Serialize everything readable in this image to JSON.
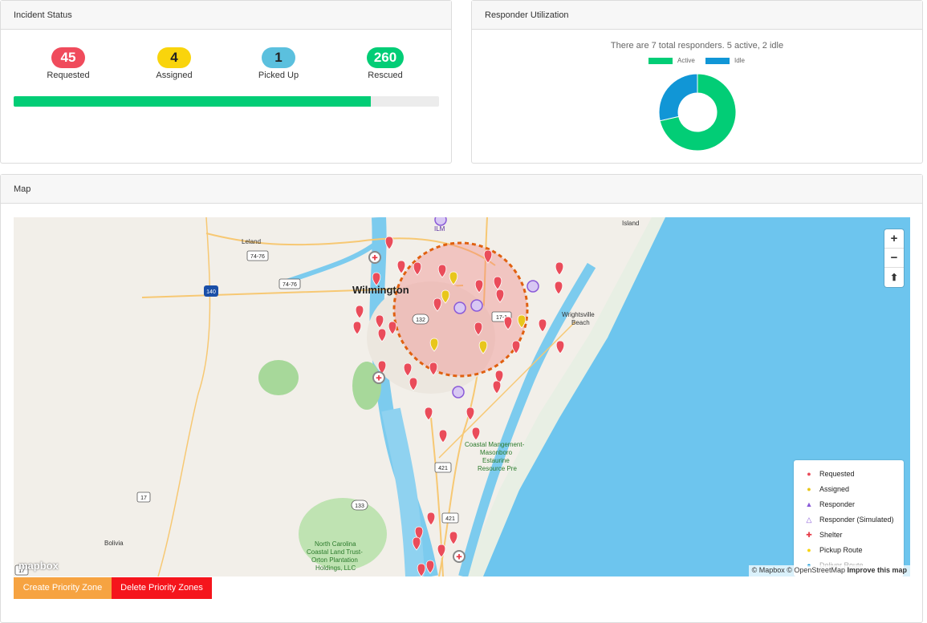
{
  "incident": {
    "title": "Incident Status",
    "stats": [
      {
        "value": "45",
        "label": "Requested",
        "color": "#f04b5c",
        "text_color": "#ffffff"
      },
      {
        "value": "4",
        "label": "Assigned",
        "color": "#f9d40c",
        "text_color": "#222222"
      },
      {
        "value": "1",
        "label": "Picked Up",
        "color": "#5bc0de",
        "text_color": "#222222"
      },
      {
        "value": "260",
        "label": "Rescued",
        "color": "#02cd76",
        "text_color": "#ffffff"
      }
    ],
    "progress_fraction": 0.84
  },
  "utilization": {
    "title": "Responder Utilization",
    "summary": "There are 7 total responders. 5 active, 2 idle",
    "legend": [
      {
        "label": "Active",
        "color": "#02cd76"
      },
      {
        "label": "Idle",
        "color": "#1196d6"
      }
    ],
    "chart_data": {
      "type": "pie",
      "categories": [
        "Active",
        "Idle"
      ],
      "values": [
        5,
        2
      ]
    }
  },
  "map_panel": {
    "title": "Map",
    "place_labels": {
      "wilmington": "Wilmington",
      "leland": "Leland",
      "wrightsville": "Wrightsville",
      "beach": "Beach",
      "bolivia": "Bolivia",
      "ilm": "ILM",
      "island": "Island",
      "coastal1": "Coastal Mangement-",
      "coastal2": "Masonboro",
      "coastal3": "Estaurine",
      "coastal4": "Resource Pre",
      "nc1": "North Carolina",
      "nc2": "Coastal Land Trust-",
      "nc3": "Orton Plantation",
      "nc4": "Holdings, LLC"
    },
    "road_shields": [
      "74-76",
      "74-76",
      "140",
      "17",
      "17",
      "421",
      "421",
      "133",
      "132",
      "17-1"
    ],
    "controls": {
      "zoom_in": "+",
      "zoom_out": "−",
      "reset": "⬆"
    },
    "legend": [
      {
        "label": "Requested",
        "icon": "requested-pin-icon",
        "color": "#ea4c5a"
      },
      {
        "label": "Assigned",
        "icon": "assigned-pin-icon",
        "color": "#e8c61b"
      },
      {
        "label": "Responder",
        "icon": "responder-icon",
        "color": "#8a5ad8"
      },
      {
        "label": "Responder (Simulated)",
        "icon": "responder-simulated-icon",
        "color": "#8a5ad8"
      },
      {
        "label": "Shelter",
        "icon": "shelter-icon",
        "color": "#e63946"
      },
      {
        "label": "Pickup Route",
        "icon": "pickup-route-dot",
        "color": "#f9d40c"
      },
      {
        "label": "Deliver Route",
        "icon": "deliver-route-dot",
        "color": "#1196d6"
      }
    ],
    "attribution": {
      "mapbox": "© Mapbox",
      "osm": "© OpenStreetMap",
      "improve": "Improve this map"
    },
    "logo": "mapbox"
  },
  "buttons": {
    "create": "Create Priority Zone",
    "delete": "Delete Priority Zones"
  }
}
